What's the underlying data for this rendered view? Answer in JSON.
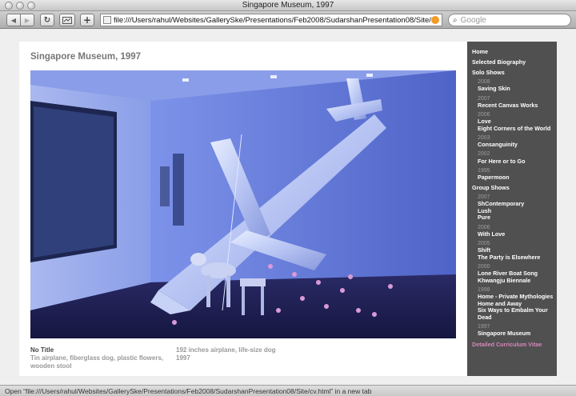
{
  "window": {
    "title": "Singapore Museum, 1997"
  },
  "toolbar": {
    "back_glyph": "◀",
    "forward_glyph": "▶",
    "reload_glyph": "↻",
    "add_bookmark_glyph": "+",
    "url": "file:///Users/rahul/Websites/GallerySke/Presentations/Feb2008/SudarshanPresentation08/Site/Si",
    "search_placeholder": "Google"
  },
  "page": {
    "title": "Singapore Museum, 1997",
    "caption": {
      "title": "No Title",
      "materials": "Tin airplane, fiberglass dog, plastic flowers, wooden stool",
      "dimensions": "192 inches airplane, life-size dog",
      "year": "1997"
    }
  },
  "sidebar": {
    "top_links": [
      "Home",
      "Selected Biography"
    ],
    "solo_heading": "Solo Shows",
    "solo": [
      {
        "year": "2008",
        "items": [
          "Saving Skin"
        ]
      },
      {
        "year": "2007",
        "items": [
          "Recent Canvas Works"
        ]
      },
      {
        "year": "2006",
        "items": [
          "Love",
          "Eight Corners of the World"
        ]
      },
      {
        "year": "2003",
        "items": [
          "Consanguinity"
        ]
      },
      {
        "year": "2002",
        "items": [
          "For Here or to Go"
        ]
      },
      {
        "year": "1995",
        "items": [
          "Papermoon"
        ]
      }
    ],
    "group_heading": "Group Shows",
    "group": [
      {
        "year": "2007",
        "items": [
          "ShContemporary",
          "Lush",
          "Pure"
        ]
      },
      {
        "year": "2006",
        "items": [
          "With Love"
        ]
      },
      {
        "year": "2005",
        "items": [
          "Shift",
          "The Party is Elsewhere"
        ]
      },
      {
        "year": "2000",
        "items": [
          "Lone River Boat Song",
          "Khwangju Biennale"
        ]
      },
      {
        "year": "1998",
        "items": [
          "Home - Private Mythologies",
          "Home and Away",
          "Six Ways to Embalm Your Dead"
        ]
      },
      {
        "year": "1997",
        "items": [
          "Singapore Museum"
        ]
      }
    ],
    "cv_link": "Detailed Curriculum Vitae"
  },
  "status": {
    "text": "Open “file:///Users/rahul/Websites/GallerySke/Presentations/Feb2008/SudarshanPresentation08/Site/cv.html” in a new tab"
  },
  "colors": {
    "sidebar_bg": "#505050",
    "sidebar_link": "#ffffff",
    "sidebar_year": "#9d9d9d",
    "cv_link": "#d787b8",
    "photo_tint": "#5a6fcf"
  }
}
